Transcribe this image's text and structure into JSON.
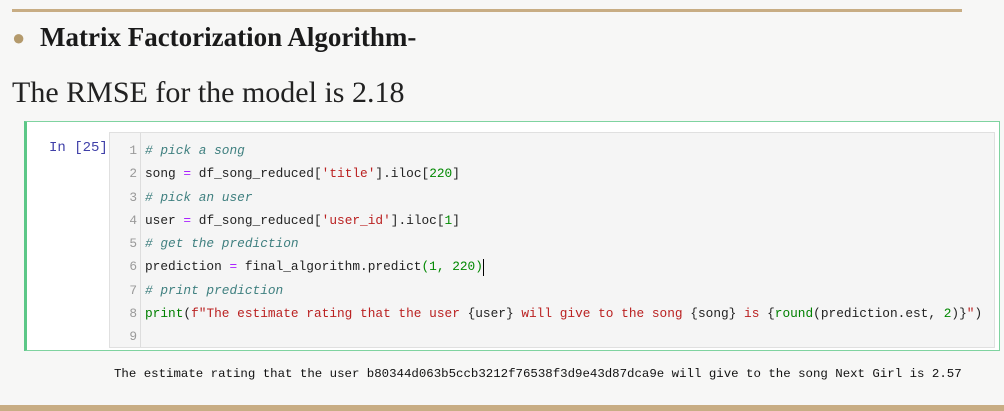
{
  "slide": {
    "bullet_title": "Matrix Factorization Algorithm-",
    "rmse_text": "The RMSE for the model is 2.18"
  },
  "cell": {
    "prompt": "In [25]:",
    "lines": [
      [
        [
          "# pick a song",
          "comment"
        ]
      ],
      [
        [
          "song ",
          "plain"
        ],
        [
          "=",
          "op"
        ],
        [
          " df_song_reduced[",
          "plain"
        ],
        [
          "'title'",
          "str"
        ],
        [
          "].iloc[",
          "plain"
        ],
        [
          "220",
          "num"
        ],
        [
          "]",
          "plain"
        ]
      ],
      [
        [
          "# pick an user",
          "comment"
        ]
      ],
      [
        [
          "user ",
          "plain"
        ],
        [
          "=",
          "op"
        ],
        [
          " df_song_reduced[",
          "plain"
        ],
        [
          "'user_id'",
          "str"
        ],
        [
          "].iloc[",
          "plain"
        ],
        [
          "1",
          "num"
        ],
        [
          "]",
          "plain"
        ]
      ],
      [
        [
          "# get the prediction",
          "comment"
        ]
      ],
      [
        [
          "prediction ",
          "plain"
        ],
        [
          "=",
          "op"
        ],
        [
          " final_algorithm.predict",
          "plain"
        ],
        [
          "(1, 220)",
          "num"
        ]
      ],
      [
        [
          "# print prediction",
          "comment"
        ]
      ],
      [
        [
          "print",
          "builtin"
        ],
        [
          "(",
          "plain"
        ],
        [
          "f\"The estimate rating that the user ",
          "str"
        ],
        [
          "{user}",
          "plain"
        ],
        [
          " will give to the song ",
          "str"
        ],
        [
          "{song}",
          "plain"
        ],
        [
          " is ",
          "str"
        ],
        [
          "{",
          "plain"
        ],
        [
          "round",
          "builtin"
        ],
        [
          "(prediction.est, ",
          "plain"
        ],
        [
          "2",
          "num"
        ],
        [
          ")}",
          "plain"
        ],
        [
          "\"",
          "str"
        ],
        [
          ")",
          "plain"
        ]
      ],
      []
    ],
    "cursor_line": 6,
    "output": "The estimate rating that the user b80344d063b5ccb3212f76538f3d9e43d87dca9e will give to the song Next Girl is 2.57"
  }
}
